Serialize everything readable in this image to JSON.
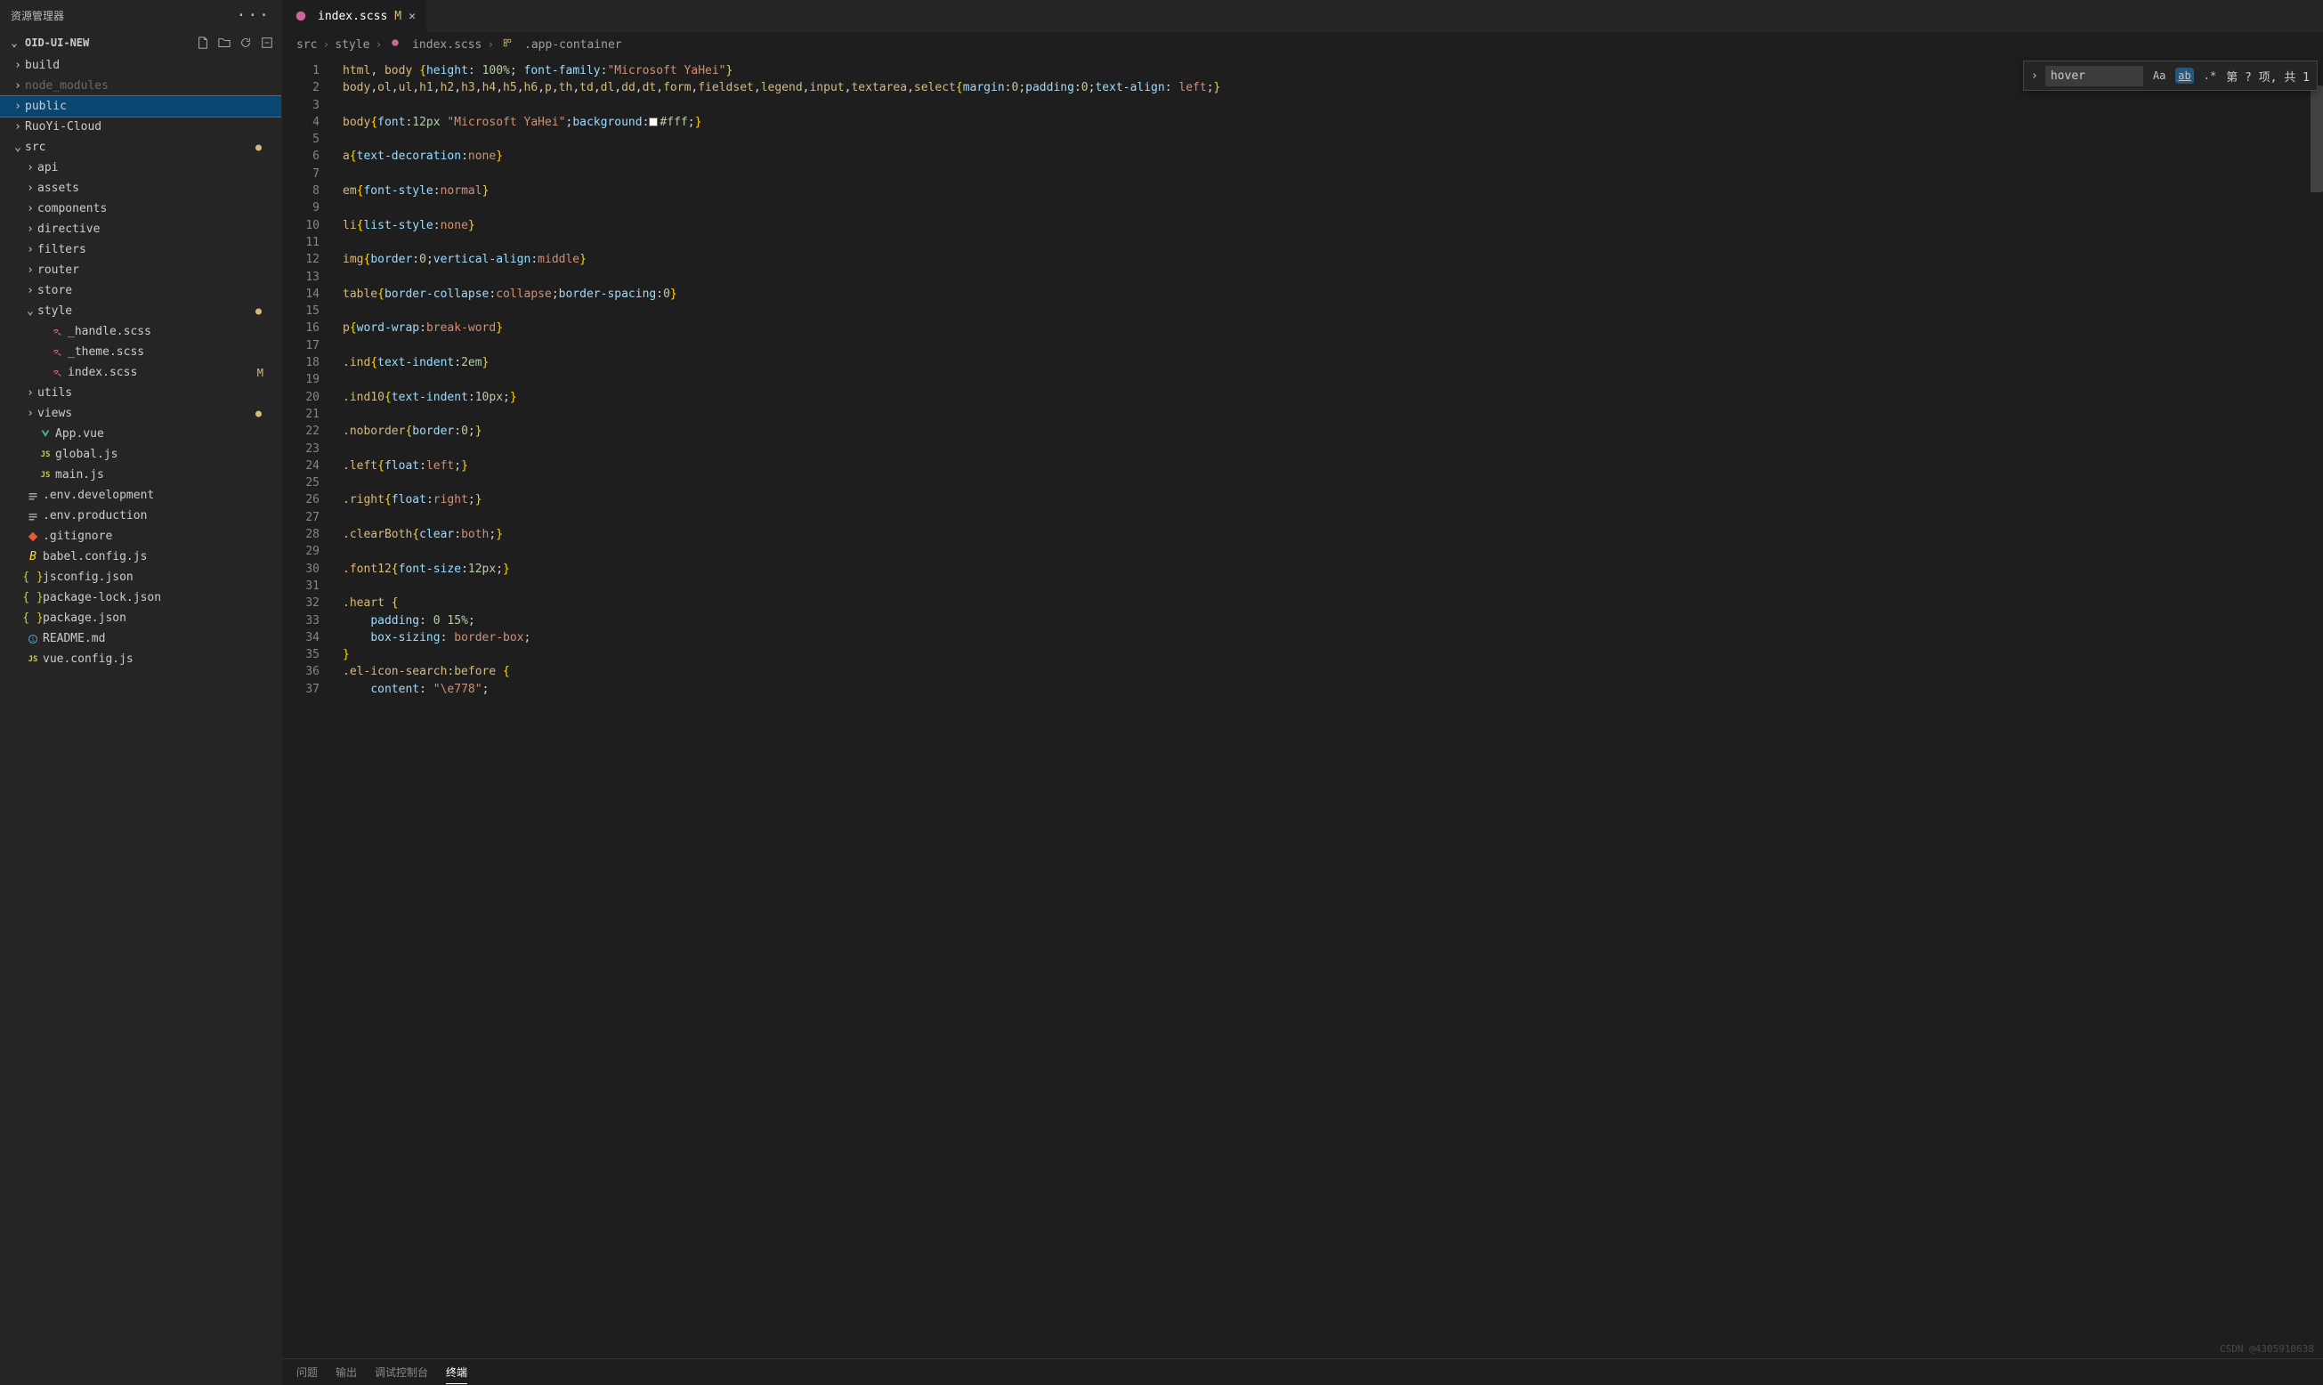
{
  "sidebar": {
    "title": "资源管理器",
    "project": "OID-UI-NEW",
    "actions": [
      "new-file",
      "new-folder",
      "refresh",
      "collapse"
    ],
    "tree": [
      {
        "l": "build",
        "d": 1,
        "t": "folder",
        "open": false
      },
      {
        "l": "node_modules",
        "d": 1,
        "t": "folder",
        "open": false,
        "muted": true
      },
      {
        "l": "public",
        "d": 1,
        "t": "folder",
        "open": false,
        "sel": true
      },
      {
        "l": "RuoYi-Cloud",
        "d": 1,
        "t": "folder",
        "open": false
      },
      {
        "l": "src",
        "d": 1,
        "t": "folder",
        "open": true,
        "dot": true
      },
      {
        "l": "api",
        "d": 2,
        "t": "folder",
        "open": false
      },
      {
        "l": "assets",
        "d": 2,
        "t": "folder",
        "open": false
      },
      {
        "l": "components",
        "d": 2,
        "t": "folder",
        "open": false
      },
      {
        "l": "directive",
        "d": 2,
        "t": "folder",
        "open": false
      },
      {
        "l": "filters",
        "d": 2,
        "t": "folder",
        "open": false
      },
      {
        "l": "router",
        "d": 2,
        "t": "folder",
        "open": false
      },
      {
        "l": "store",
        "d": 2,
        "t": "folder",
        "open": false
      },
      {
        "l": "style",
        "d": 2,
        "t": "folder",
        "open": true,
        "dot": true
      },
      {
        "l": "_handle.scss",
        "d": 3,
        "t": "sass"
      },
      {
        "l": "_theme.scss",
        "d": 3,
        "t": "sass"
      },
      {
        "l": "index.scss",
        "d": 3,
        "t": "sass",
        "m": true
      },
      {
        "l": "utils",
        "d": 2,
        "t": "folder",
        "open": false
      },
      {
        "l": "views",
        "d": 2,
        "t": "folder",
        "open": false,
        "dot": true
      },
      {
        "l": "App.vue",
        "d": 2,
        "t": "vue"
      },
      {
        "l": "global.js",
        "d": 2,
        "t": "js"
      },
      {
        "l": "main.js",
        "d": 2,
        "t": "js"
      },
      {
        "l": ".env.development",
        "d": 1,
        "t": "env"
      },
      {
        "l": ".env.production",
        "d": 1,
        "t": "env"
      },
      {
        "l": ".gitignore",
        "d": 1,
        "t": "git"
      },
      {
        "l": "babel.config.js",
        "d": 1,
        "t": "babel"
      },
      {
        "l": "jsconfig.json",
        "d": 1,
        "t": "json"
      },
      {
        "l": "package-lock.json",
        "d": 1,
        "t": "json"
      },
      {
        "l": "package.json",
        "d": 1,
        "t": "json"
      },
      {
        "l": "README.md",
        "d": 1,
        "t": "md"
      },
      {
        "l": "vue.config.js",
        "d": 1,
        "t": "js"
      }
    ]
  },
  "tab": {
    "icon": "sass",
    "name": "index.scss",
    "badge": "M"
  },
  "breadcrumbs": [
    "src",
    "style",
    "index.scss",
    ".app-container"
  ],
  "find": {
    "value": "hover",
    "result": "第 ? 项, 共 1"
  },
  "code_lines": [
    [
      [
        "s-sel",
        "html"
      ],
      [
        "s-pun",
        ", "
      ],
      [
        "s-sel",
        "body "
      ],
      [
        "s-br",
        "{"
      ],
      [
        "s-prop",
        "height"
      ],
      [
        "s-pun",
        ": "
      ],
      [
        "s-num",
        "100%"
      ],
      [
        "s-pun",
        "; "
      ],
      [
        "s-prop",
        "font-family"
      ],
      [
        "s-pun",
        ":"
      ],
      [
        "s-str",
        "\"Microsoft YaHei\""
      ],
      [
        "s-br",
        "}"
      ]
    ],
    [
      [
        "s-sel",
        "body"
      ],
      [
        "s-pun",
        ","
      ],
      [
        "s-sel",
        "ol"
      ],
      [
        "s-pun",
        ","
      ],
      [
        "s-sel",
        "ul"
      ],
      [
        "s-pun",
        ","
      ],
      [
        "s-sel",
        "h1"
      ],
      [
        "s-pun",
        ","
      ],
      [
        "s-sel",
        "h2"
      ],
      [
        "s-pun",
        ","
      ],
      [
        "s-sel",
        "h3"
      ],
      [
        "s-pun",
        ","
      ],
      [
        "s-sel",
        "h4"
      ],
      [
        "s-pun",
        ","
      ],
      [
        "s-sel",
        "h5"
      ],
      [
        "s-pun",
        ","
      ],
      [
        "s-sel",
        "h6"
      ],
      [
        "s-pun",
        ","
      ],
      [
        "s-sel",
        "p"
      ],
      [
        "s-pun",
        ","
      ],
      [
        "s-sel",
        "th"
      ],
      [
        "s-pun",
        ","
      ],
      [
        "s-sel",
        "td"
      ],
      [
        "s-pun",
        ","
      ],
      [
        "s-sel",
        "dl"
      ],
      [
        "s-pun",
        ","
      ],
      [
        "s-sel",
        "dd"
      ],
      [
        "s-pun",
        ","
      ],
      [
        "s-sel",
        "dt"
      ],
      [
        "s-pun",
        ","
      ],
      [
        "s-sel",
        "form"
      ],
      [
        "s-pun",
        ","
      ],
      [
        "s-sel",
        "fieldset"
      ],
      [
        "s-pun",
        ","
      ],
      [
        "s-sel",
        "legend"
      ],
      [
        "s-pun",
        ","
      ],
      [
        "s-sel",
        "input"
      ],
      [
        "s-pun",
        ","
      ],
      [
        "s-sel",
        "textarea"
      ],
      [
        "s-pun",
        ","
      ],
      [
        "s-sel",
        "select"
      ],
      [
        "s-br",
        "{"
      ],
      [
        "s-prop",
        "margin"
      ],
      [
        "s-pun",
        ":"
      ],
      [
        "s-num",
        "0"
      ],
      [
        "s-pun",
        ";"
      ],
      [
        "s-prop",
        "padding"
      ],
      [
        "s-pun",
        ":"
      ],
      [
        "s-num",
        "0"
      ],
      [
        "s-pun",
        ";"
      ],
      [
        "s-prop",
        "text-align"
      ],
      [
        "s-pun",
        ": "
      ],
      [
        "s-val",
        "left"
      ],
      [
        "s-pun",
        ";"
      ],
      [
        "s-br",
        "}"
      ]
    ],
    [],
    [
      [
        "s-sel",
        "body"
      ],
      [
        "s-br",
        "{"
      ],
      [
        "s-prop",
        "font"
      ],
      [
        "s-pun",
        ":"
      ],
      [
        "s-num",
        "12px"
      ],
      [
        "s-pun",
        " "
      ],
      [
        "s-str",
        "\"Microsoft YaHei\""
      ],
      [
        "s-pun",
        ";"
      ],
      [
        "s-prop",
        "background"
      ],
      [
        "s-pun",
        ":"
      ],
      [
        "swatch",
        ""
      ],
      [
        "s-num",
        "#fff"
      ],
      [
        "s-pun",
        ";"
      ],
      [
        "s-br",
        "}"
      ]
    ],
    [],
    [
      [
        "s-sel",
        "a"
      ],
      [
        "s-br",
        "{"
      ],
      [
        "s-prop",
        "text-decoration"
      ],
      [
        "s-pun",
        ":"
      ],
      [
        "s-val",
        "none"
      ],
      [
        "s-br",
        "}"
      ]
    ],
    [],
    [
      [
        "s-sel",
        "em"
      ],
      [
        "s-br",
        "{"
      ],
      [
        "s-prop",
        "font-style"
      ],
      [
        "s-pun",
        ":"
      ],
      [
        "s-val",
        "normal"
      ],
      [
        "s-br",
        "}"
      ]
    ],
    [],
    [
      [
        "s-sel",
        "li"
      ],
      [
        "s-br",
        "{"
      ],
      [
        "s-prop",
        "list-style"
      ],
      [
        "s-pun",
        ":"
      ],
      [
        "s-val",
        "none"
      ],
      [
        "s-br",
        "}"
      ]
    ],
    [],
    [
      [
        "s-sel",
        "img"
      ],
      [
        "s-br",
        "{"
      ],
      [
        "s-prop",
        "border"
      ],
      [
        "s-pun",
        ":"
      ],
      [
        "s-num",
        "0"
      ],
      [
        "s-pun",
        ";"
      ],
      [
        "s-prop",
        "vertical-align"
      ],
      [
        "s-pun",
        ":"
      ],
      [
        "s-val",
        "middle"
      ],
      [
        "s-br",
        "}"
      ]
    ],
    [],
    [
      [
        "s-sel",
        "table"
      ],
      [
        "s-br",
        "{"
      ],
      [
        "s-prop",
        "border-collapse"
      ],
      [
        "s-pun",
        ":"
      ],
      [
        "s-val",
        "collapse"
      ],
      [
        "s-pun",
        ";"
      ],
      [
        "s-prop",
        "border-spacing"
      ],
      [
        "s-pun",
        ":"
      ],
      [
        "s-num",
        "0"
      ],
      [
        "s-br",
        "}"
      ]
    ],
    [],
    [
      [
        "s-sel",
        "p"
      ],
      [
        "s-br",
        "{"
      ],
      [
        "s-prop",
        "word-wrap"
      ],
      [
        "s-pun",
        ":"
      ],
      [
        "s-val",
        "break-word"
      ],
      [
        "s-br",
        "}"
      ]
    ],
    [],
    [
      [
        "s-sel",
        ".ind"
      ],
      [
        "s-br",
        "{"
      ],
      [
        "s-prop",
        "text-indent"
      ],
      [
        "s-pun",
        ":"
      ],
      [
        "s-num",
        "2em"
      ],
      [
        "s-br",
        "}"
      ]
    ],
    [],
    [
      [
        "s-sel",
        ".ind10"
      ],
      [
        "s-br",
        "{"
      ],
      [
        "s-prop",
        "text-indent"
      ],
      [
        "s-pun",
        ":"
      ],
      [
        "s-num",
        "10px"
      ],
      [
        "s-pun",
        ";"
      ],
      [
        "s-br",
        "}"
      ]
    ],
    [],
    [
      [
        "s-sel",
        ".noborder"
      ],
      [
        "s-br",
        "{"
      ],
      [
        "s-prop",
        "border"
      ],
      [
        "s-pun",
        ":"
      ],
      [
        "s-num",
        "0"
      ],
      [
        "s-pun",
        ";"
      ],
      [
        "s-br",
        "}"
      ]
    ],
    [],
    [
      [
        "s-sel",
        ".left"
      ],
      [
        "s-br",
        "{"
      ],
      [
        "s-prop",
        "float"
      ],
      [
        "s-pun",
        ":"
      ],
      [
        "s-val",
        "left"
      ],
      [
        "s-pun",
        ";"
      ],
      [
        "s-br",
        "}"
      ]
    ],
    [],
    [
      [
        "s-sel",
        ".right"
      ],
      [
        "s-br",
        "{"
      ],
      [
        "s-prop",
        "float"
      ],
      [
        "s-pun",
        ":"
      ],
      [
        "s-val",
        "right"
      ],
      [
        "s-pun",
        ";"
      ],
      [
        "s-br",
        "}"
      ]
    ],
    [],
    [
      [
        "s-sel",
        ".clearBoth"
      ],
      [
        "s-br",
        "{"
      ],
      [
        "s-prop",
        "clear"
      ],
      [
        "s-pun",
        ":"
      ],
      [
        "s-val",
        "both"
      ],
      [
        "s-pun",
        ";"
      ],
      [
        "s-br",
        "}"
      ]
    ],
    [],
    [
      [
        "s-sel",
        ".font12"
      ],
      [
        "s-br",
        "{"
      ],
      [
        "s-prop",
        "font-size"
      ],
      [
        "s-pun",
        ":"
      ],
      [
        "s-num",
        "12px"
      ],
      [
        "s-pun",
        ";"
      ],
      [
        "s-br",
        "}"
      ]
    ],
    [],
    [
      [
        "s-sel",
        ".heart "
      ],
      [
        "s-br",
        "{"
      ]
    ],
    [
      [
        "s-pun",
        "    "
      ],
      [
        "s-prop",
        "padding"
      ],
      [
        "s-pun",
        ": "
      ],
      [
        "s-num",
        "0"
      ],
      [
        "s-pun",
        " "
      ],
      [
        "s-num",
        "15%"
      ],
      [
        "s-pun",
        ";"
      ]
    ],
    [
      [
        "s-pun",
        "    "
      ],
      [
        "s-prop",
        "box-sizing"
      ],
      [
        "s-pun",
        ": "
      ],
      [
        "s-val",
        "border-box"
      ],
      [
        "s-pun",
        ";"
      ]
    ],
    [
      [
        "s-br",
        "}"
      ]
    ],
    [
      [
        "s-sel",
        ".el-icon-search:before "
      ],
      [
        "s-br",
        "{"
      ]
    ],
    [
      [
        "s-pun",
        "    "
      ],
      [
        "s-prop",
        "content"
      ],
      [
        "s-pun",
        ": "
      ],
      [
        "s-str",
        "\"\\e778\""
      ],
      [
        "s-pun",
        ";"
      ]
    ]
  ],
  "panel": {
    "tabs": [
      "问题",
      "输出",
      "调试控制台",
      "终端"
    ],
    "active": 3
  },
  "watermark": "CSDN @4305910638"
}
